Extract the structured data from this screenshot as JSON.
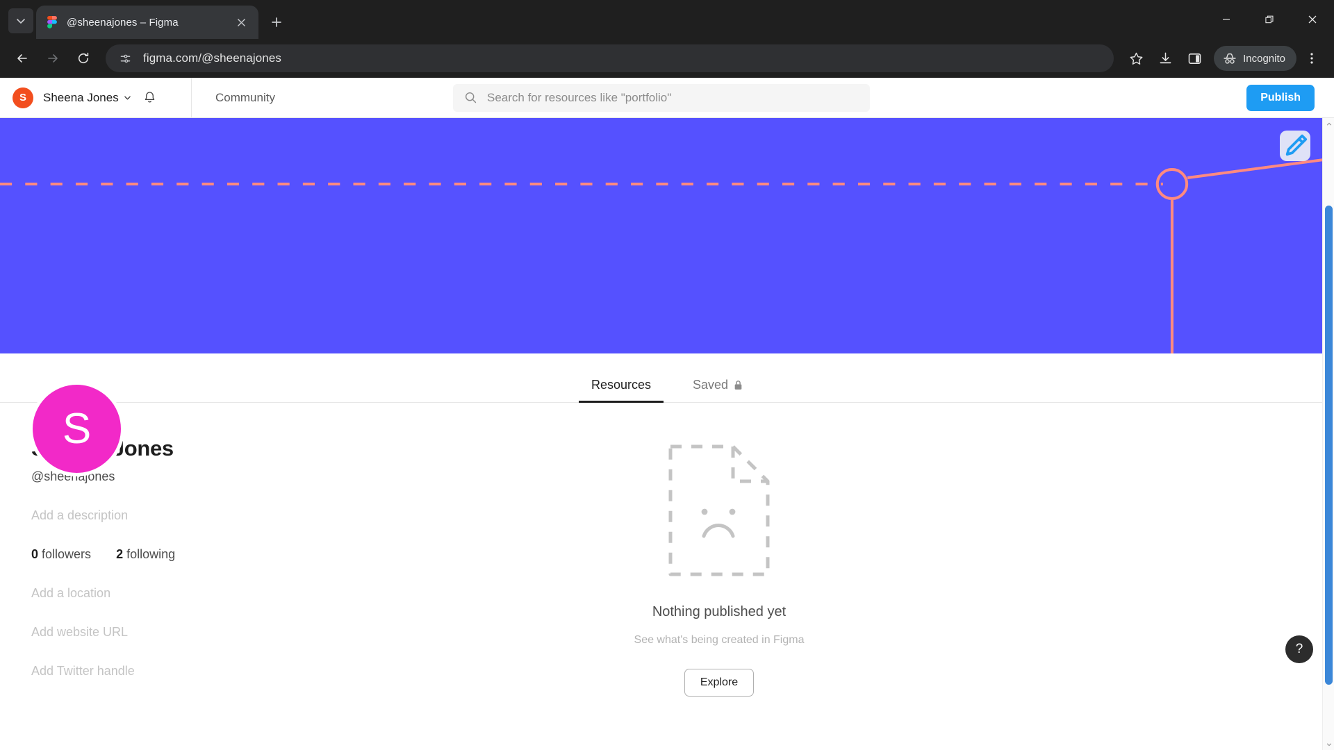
{
  "browser": {
    "tab": {
      "title": "@sheenajones – Figma",
      "favicon_icon": "figma-logo-icon",
      "close_icon": "close-icon"
    },
    "tab_list_icon": "chevron-down-icon",
    "new_tab_icon": "plus-icon",
    "window_controls": {
      "minimize_icon": "minimize-icon",
      "restore_icon": "restore-icon",
      "close_icon": "close-icon"
    },
    "toolbar": {
      "back_icon": "back-arrow-icon",
      "forward_icon": "forward-arrow-icon",
      "reload_icon": "reload-icon",
      "site_info_icon": "site-settings-icon",
      "url": "figma.com/@sheenajones",
      "bookmark_icon": "star-icon",
      "downloads_icon": "download-icon",
      "side_panel_icon": "side-panel-icon",
      "incognito_label": "Incognito",
      "incognito_icon": "incognito-hat-icon",
      "menu_icon": "three-dot-menu-icon"
    }
  },
  "figma": {
    "nav": {
      "avatar_initial": "S",
      "user_name": "Sheena Jones",
      "user_chevron_icon": "chevron-down-icon",
      "notifications_icon": "bell-icon",
      "community_label": "Community",
      "search_icon": "search-icon",
      "search_placeholder": "Search for resources like \"portfolio\"",
      "search_value": "",
      "publish_label": "Publish"
    },
    "banner": {
      "background_color": "#5551ff",
      "accent_color": "#ff8a80",
      "edit_icon": "edit-pencil-icon",
      "edit_button_bg": "#dfe2f7",
      "cursor_icon": "mouse-pointer-icon"
    },
    "profile": {
      "avatar_initial": "S",
      "avatar_color": "#f229c8",
      "name": "Sheena Jones",
      "handle": "@sheenajones",
      "description_placeholder": "Add a description",
      "location_placeholder": "Add a location",
      "website_placeholder": "Add website URL",
      "twitter_placeholder": "Add Twitter handle",
      "followers_count": "0",
      "followers_label": "followers",
      "following_count": "2",
      "following_label": "following"
    },
    "tabs": [
      {
        "label": "Resources",
        "active": true,
        "lock": false
      },
      {
        "label": "Saved",
        "active": false,
        "lock": true,
        "lock_icon": "lock-icon"
      }
    ],
    "empty_state": {
      "illustration_icon": "sad-document-icon",
      "title": "Nothing published yet",
      "subtitle": "See what's being created in Figma",
      "button_label": "Explore"
    },
    "help_button": {
      "label": "?",
      "icon": "question-mark-icon"
    },
    "scrollbar": {
      "thumb_color": "#3b87d8"
    }
  }
}
